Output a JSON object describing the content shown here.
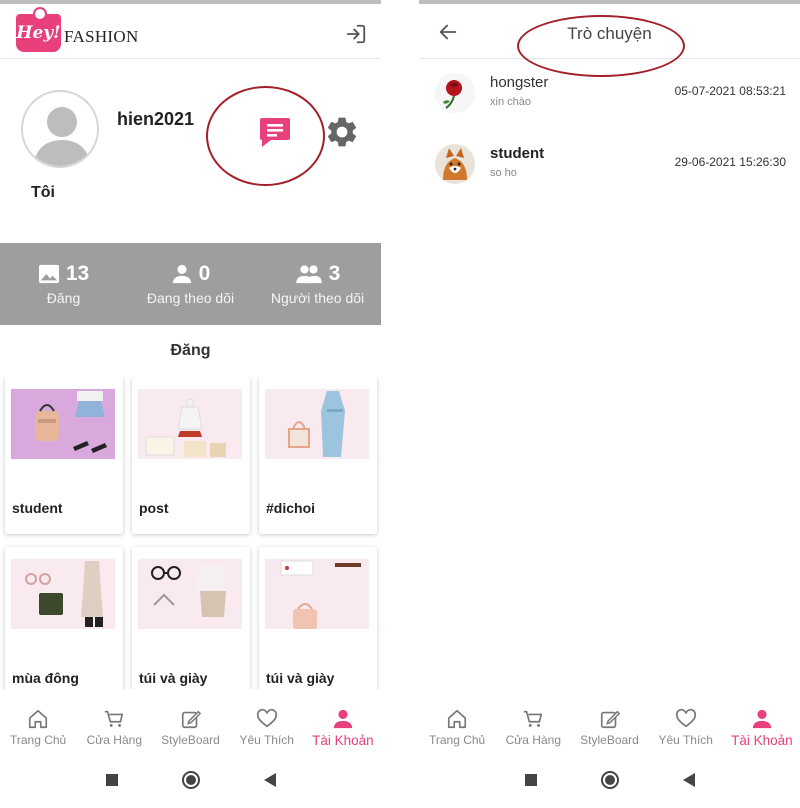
{
  "left": {
    "logo": {
      "tag": "Hey!",
      "text": "FASHION"
    },
    "profile": {
      "username": "hien2021",
      "caption": "Tôi"
    },
    "stats": [
      {
        "value": "13",
        "label": "Đăng",
        "icon": "image-icon"
      },
      {
        "value": "0",
        "label": "Đang theo dõi",
        "icon": "person-icon"
      },
      {
        "value": "3",
        "label": "Người theo dõi",
        "icon": "group-icon"
      }
    ],
    "section_title": "Đăng",
    "posts": [
      {
        "title": "student",
        "bg": "#d9a8dd"
      },
      {
        "title": "post",
        "bg": "#f8eaee"
      },
      {
        "title": "#dichoi",
        "bg": "#f8eaee"
      },
      {
        "title": "mùa đông",
        "bg": "#f8eaee"
      },
      {
        "title": "túi và giày",
        "bg": "#f8eaee"
      },
      {
        "title": "túi và giày",
        "bg": "#f8eaee"
      }
    ]
  },
  "right": {
    "title": "Trò chuyện",
    "conversations": [
      {
        "name": "hongster",
        "message": "xin chào",
        "time": "05-07-2021 08:53:21",
        "avatar": "rose-avatar"
      },
      {
        "name": "student",
        "message": "so ho",
        "time": "29-06-2021 15:26:30",
        "avatar": "dog-avatar"
      }
    ]
  },
  "nav": {
    "items": [
      {
        "label": "Trang Chủ",
        "icon": "home-icon"
      },
      {
        "label": "Cửa Hàng",
        "icon": "cart-icon"
      },
      {
        "label": "StyleBoard",
        "icon": "edit-icon"
      },
      {
        "label": "Yêu Thích",
        "icon": "heart-icon"
      },
      {
        "label": "Tài Khoản",
        "icon": "account-icon",
        "active": true
      }
    ]
  },
  "colors": {
    "accent": "#e8407a",
    "stats_bg": "#9e9e9e",
    "annotation": "#a31f2a"
  }
}
